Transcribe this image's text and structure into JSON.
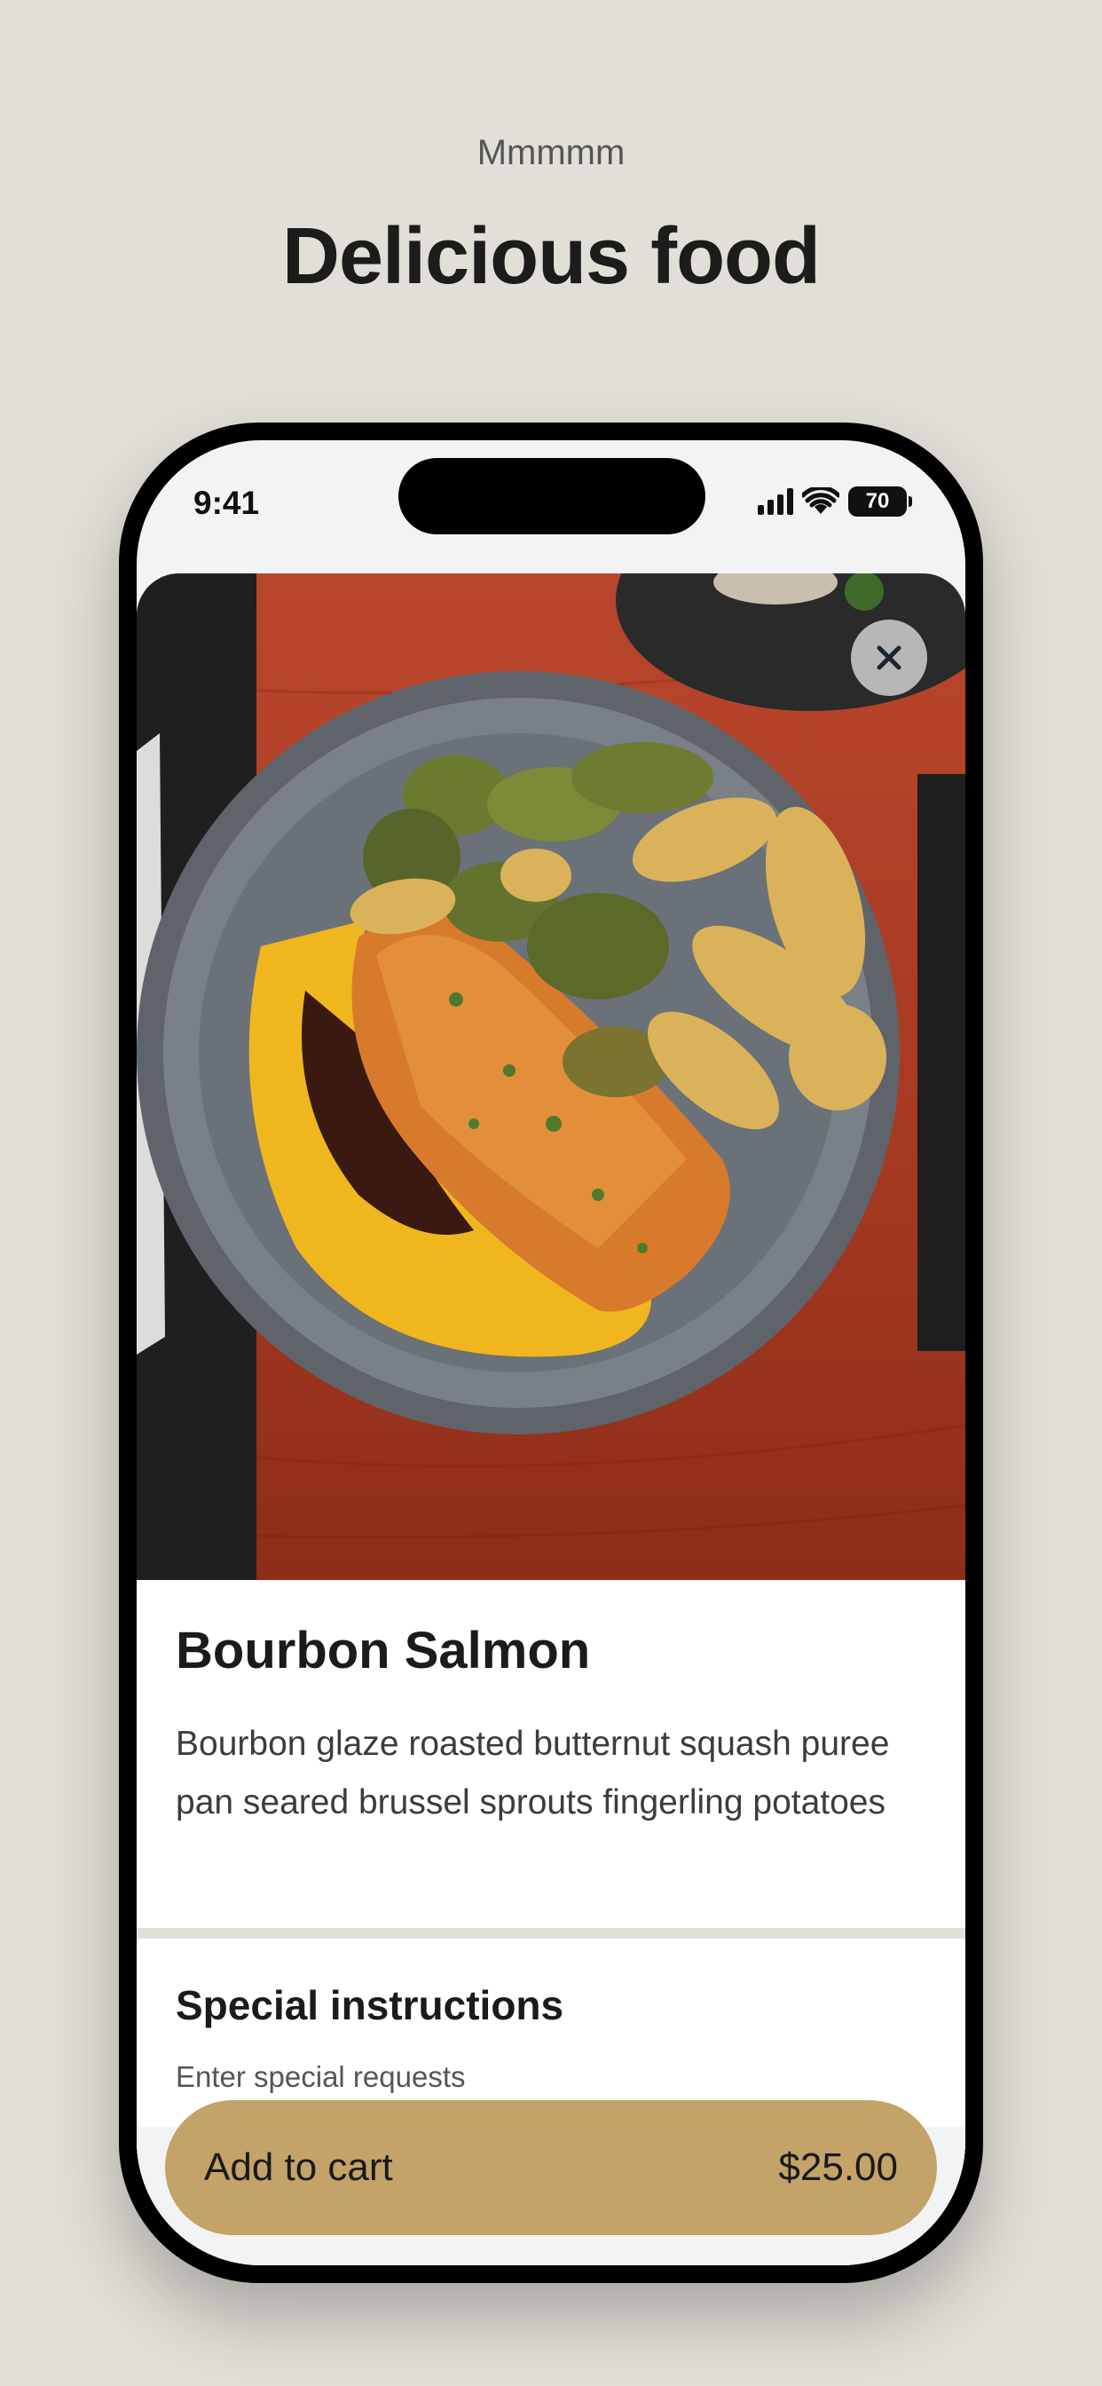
{
  "header": {
    "subtitle": "Mmmmm",
    "title": "Delicious food"
  },
  "status_bar": {
    "time": "9:41",
    "battery": "70",
    "icons": [
      "signal-icon",
      "wifi-icon",
      "battery-icon"
    ]
  },
  "product": {
    "image_description": "",
    "title": "Bourbon Salmon",
    "description": "Bourbon glaze roasted butternut squash puree pan seared brussel sprouts fingerling potatoes"
  },
  "special_instructions": {
    "title": "Special instructions",
    "placeholder": "Enter special requests"
  },
  "cart": {
    "label": "Add to cart",
    "price": "$25.00"
  },
  "colors": {
    "background": "#e2dfd8",
    "accent": "#c4a369",
    "table_wood": "#b8462c"
  }
}
